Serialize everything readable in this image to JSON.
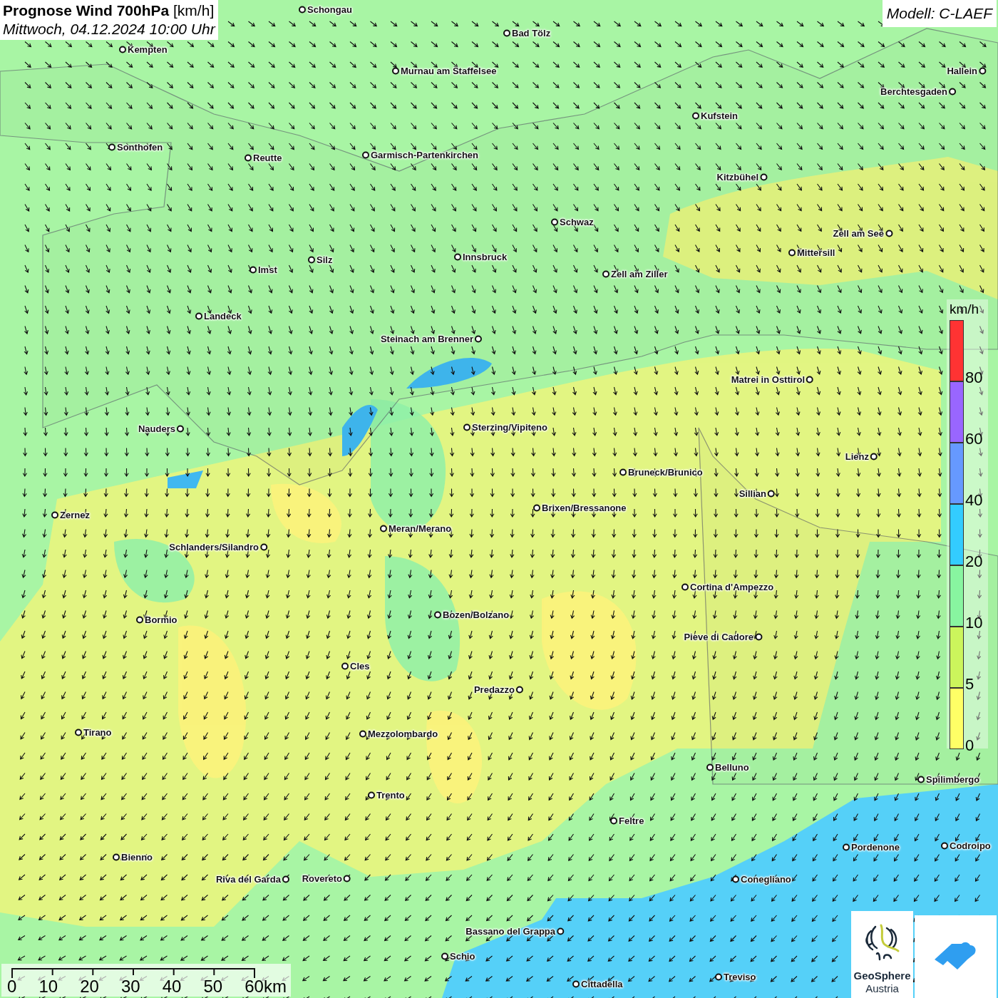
{
  "title": {
    "heading": "**Prognose Wind 700hPa** [km/h]",
    "date": "Mittwoch, 04.12.2024 10:00 Uhr"
  },
  "model": "Modell: C-LAEF",
  "cities": [
    {
      "name": "Schongau"
    },
    {
      "name": "Bad Tölz"
    },
    {
      "name": "Kempten"
    },
    {
      "name": "Murnau am Staffelsee"
    },
    {
      "name": "Hallein"
    },
    {
      "name": "Berchtesgaden"
    },
    {
      "name": "Kufstein"
    },
    {
      "name": "Sonthofen"
    },
    {
      "name": "Reutte"
    },
    {
      "name": "Garmisch-Partenkirchen"
    },
    {
      "name": "Kitzbühel"
    },
    {
      "name": "Schwaz"
    },
    {
      "name": "Zell am See"
    },
    {
      "name": "Mittersill"
    },
    {
      "name": "Innsbruck"
    },
    {
      "name": "Silz"
    },
    {
      "name": "Imst"
    },
    {
      "name": "Zell am Ziller"
    },
    {
      "name": "Landeck"
    },
    {
      "name": "Steinach am Brenner"
    },
    {
      "name": "Matrei in Osttirol"
    },
    {
      "name": "Nauders"
    },
    {
      "name": "Sterzing/Vipiteno"
    },
    {
      "name": "Lienz"
    },
    {
      "name": "Bruneck/Brunico"
    },
    {
      "name": "Sillian"
    },
    {
      "name": "Brixen/Bressanone"
    },
    {
      "name": "Zernez"
    },
    {
      "name": "Meran/Merano"
    },
    {
      "name": "Schlanders/Silandro"
    },
    {
      "name": "Cortina d'Ampezzo"
    },
    {
      "name": "Bozen/Bolzano"
    },
    {
      "name": "Bormio"
    },
    {
      "name": "Pieve di Cadore"
    },
    {
      "name": "Cles"
    },
    {
      "name": "Predazzo"
    },
    {
      "name": "Tirano"
    },
    {
      "name": "Mezzolombardo"
    },
    {
      "name": "Belluno"
    },
    {
      "name": "Spilimbergo"
    },
    {
      "name": "Trento"
    },
    {
      "name": "Feltre"
    },
    {
      "name": "Pordenone"
    },
    {
      "name": "Codroipo"
    },
    {
      "name": "Bienno"
    },
    {
      "name": "Riva del Garda"
    },
    {
      "name": "Rovereto"
    },
    {
      "name": "Conegliano"
    },
    {
      "name": "Bassano del Grappa"
    },
    {
      "name": "Schio"
    },
    {
      "name": "Treviso"
    },
    {
      "name": "Cittadella"
    }
  ],
  "legend": {
    "unit": "km/h",
    "classes": [
      {
        "label": "80",
        "color": "#ff3333"
      },
      {
        "label": "60",
        "color": "#9966ff"
      },
      {
        "label": "40",
        "color": "#6699ff"
      },
      {
        "label": "20",
        "color": "#33ccff"
      },
      {
        "label": "10",
        "color": "#88f5a0"
      },
      {
        "label": "5",
        "color": "#ccf55c"
      },
      {
        "label": "0",
        "color": "#ffff66"
      }
    ]
  },
  "scale_bar": {
    "labels": [
      "0",
      "10",
      "20",
      "30",
      "40",
      "50",
      "60km"
    ]
  },
  "logo": {
    "line1": "GeoSphere",
    "line2": "Austria"
  }
}
